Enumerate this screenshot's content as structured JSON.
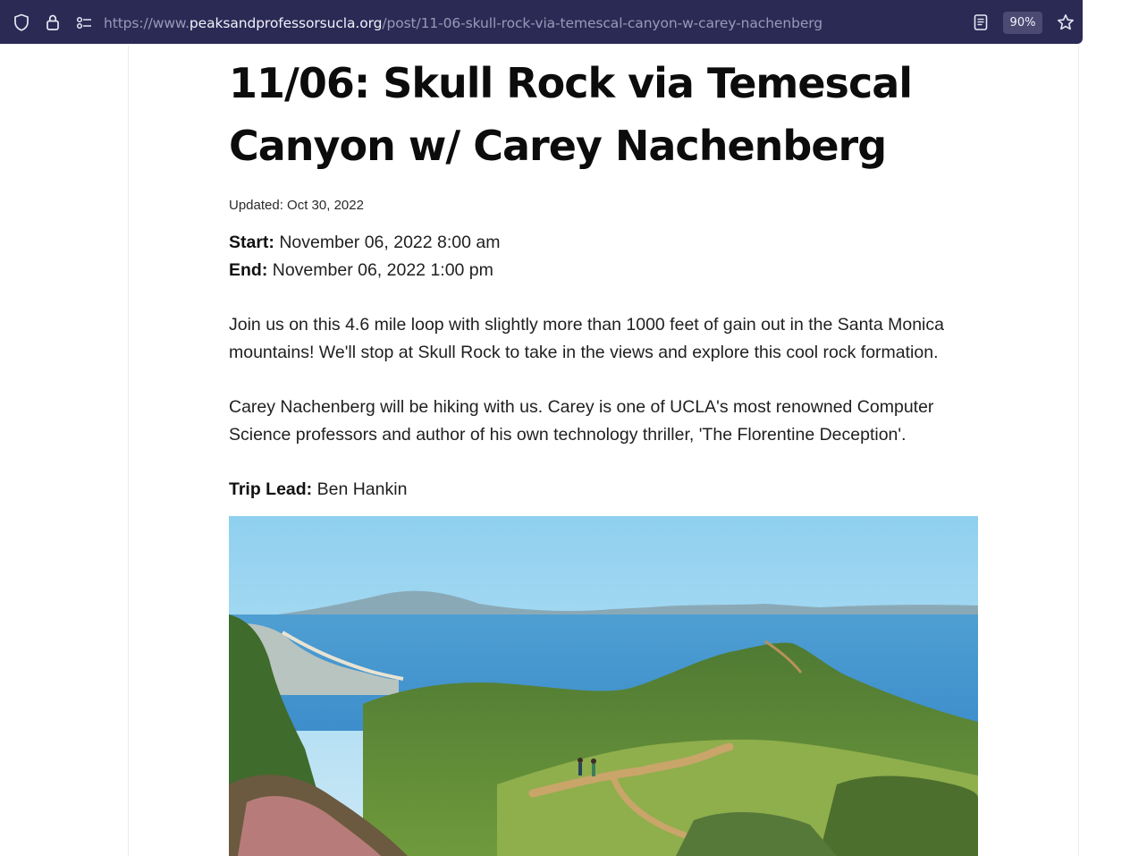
{
  "browser": {
    "url_prefix": "https://www.",
    "url_host": "peaksandprofessorsucla.org",
    "url_path": "/post/11-06-skull-rock-via-temescal-canyon-w-carey-nachenberg",
    "zoom_level": "90%",
    "icons": [
      "shield-icon",
      "lock-icon",
      "permissions-icon",
      "reader-view-icon",
      "bookmark-star-icon"
    ]
  },
  "post": {
    "title": "11/06: Skull Rock via Temescal Canyon w/ Carey Nachenberg",
    "updated": "Updated: Oct 30, 2022",
    "start_label": "Start:",
    "start_value": "November 06, 2022 8:00 am",
    "end_label": "End:",
    "end_value": "November 06, 2022 1:00 pm",
    "paragraph_1": "Join us on this 4.6 mile loop with slightly more than 1000 feet of gain out in the Santa Monica mountains! We'll stop at Skull Rock to take in the views and explore this cool rock formation.",
    "paragraph_2": "Carey Nachenberg will be hiking with us. Carey is one of UCLA's most renowned Computer Science professors and author of his own technology thriller, 'The Florentine Deception'.",
    "trip_lead_label": "Trip Lead:",
    "trip_lead_value": "Ben Hankin"
  },
  "colors": {
    "toolbar_bg": "#2b2a55",
    "url_host": "#f2f1fb",
    "url_dim": "#9a98b8",
    "zoom_badge_bg": "#4c4a73"
  }
}
